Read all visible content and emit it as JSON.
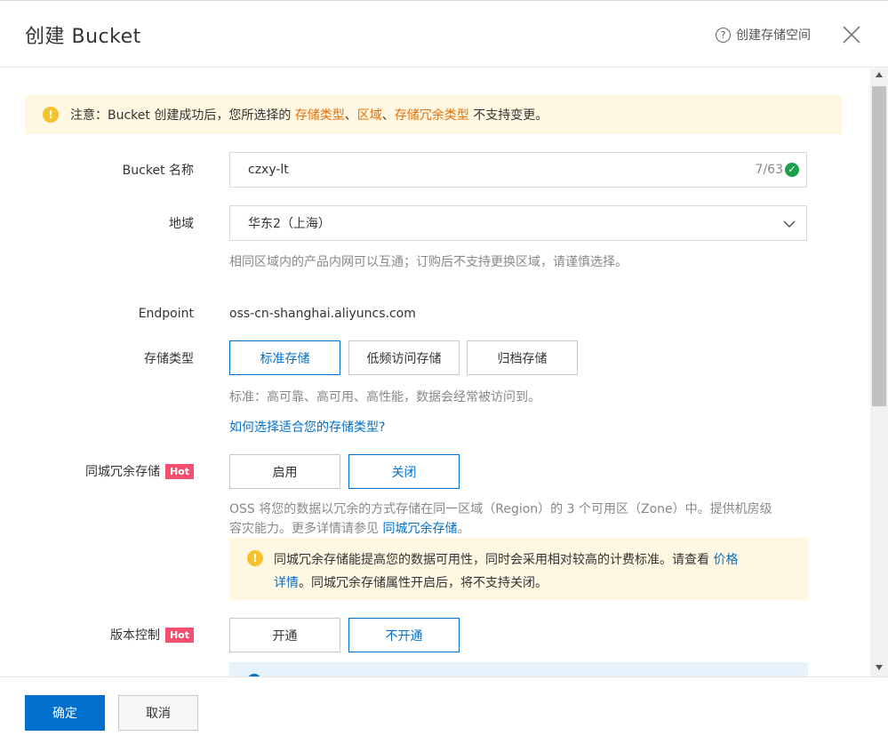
{
  "header": {
    "title": "创建 Bucket",
    "help_label": "创建存储空间"
  },
  "notice": {
    "prefix": "注意：Bucket 创建成功后，您所选择的 ",
    "storage_type": "存储类型",
    "sep1": "、",
    "region": "区域",
    "sep2": "、",
    "redundancy": "存储冗余类型",
    "suffix": " 不支持变更。"
  },
  "bucket_name": {
    "label": "Bucket 名称",
    "value": "czxy-lt",
    "counter": "7/63"
  },
  "region": {
    "label": "地域",
    "value": "华东2（上海）",
    "hint": "相同区域内的产品内网可以互通；订购后不支持更换区域，请谨慎选择。"
  },
  "endpoint": {
    "label": "Endpoint",
    "value": "oss-cn-shanghai.aliyuncs.com"
  },
  "storage_class": {
    "label": "存储类型",
    "options": [
      "标准存储",
      "低频访问存储",
      "归档存储"
    ],
    "selected": 0,
    "hint": "标准：高可靠、高可用、高性能，数据会经常被访问到。",
    "link": "如何选择适合您的存储类型?"
  },
  "zrs": {
    "label": "同城冗余存储",
    "badge": "Hot",
    "options": [
      "启用",
      "关闭"
    ],
    "selected": 1,
    "desc_line1": "OSS 将您的数据以冗余的方式存储在同一区域（Region）的 3 个可用区（Zone）中。提供机房级",
    "desc_line2_prefix": "容灾能力。更多详情请参见 ",
    "desc_link": "同城冗余存储",
    "desc_line2_suffix": "。",
    "warn_line1_prefix": "同城冗余存储能提高您的数据可用性，同时会采用相对较高的计费标准。请查看 ",
    "warn_link_a": "价格",
    "warn_link_b": "详情",
    "warn_line2_suffix": "。同城冗余存储属性开启后，将不支持关闭。"
  },
  "versioning": {
    "label": "版本控制",
    "badge": "Hot",
    "options": [
      "开通",
      "不开通"
    ],
    "selected": 1
  },
  "footer": {
    "ok": "确定",
    "cancel": "取消"
  },
  "colors": {
    "primary": "#0070cc",
    "warning_bg": "#fef7e1",
    "warning_icon": "#f5c12e",
    "hot_badge": "#f54e6e",
    "link_orange": "#e5700b",
    "success": "#1f9f4a"
  }
}
